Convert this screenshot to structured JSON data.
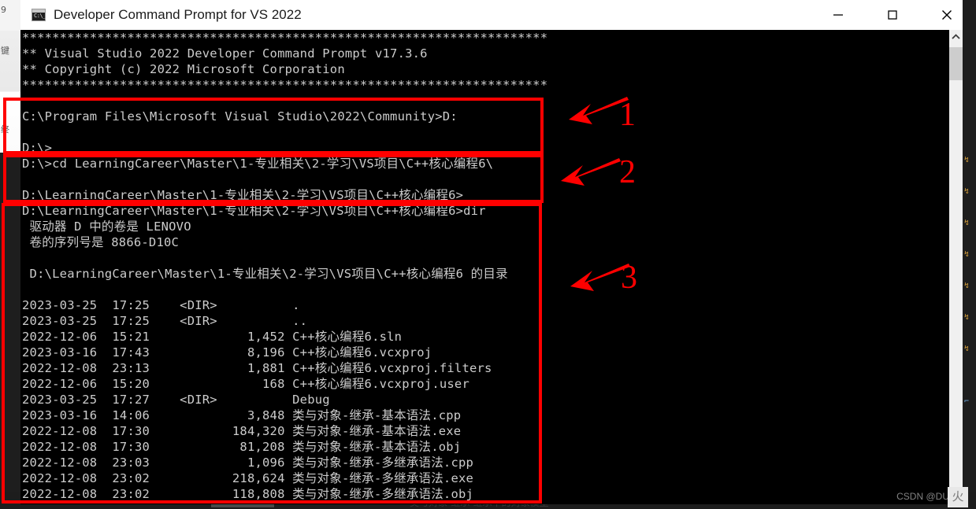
{
  "window": {
    "title": "Developer Command Prompt for VS 2022",
    "icon_name": "console-app-icon",
    "icon_text": "C:\\_",
    "controls": {
      "minimize": "Minimize",
      "maximize": "Maximize",
      "close": "Close"
    }
  },
  "scrollbar": {
    "up_arrow": "scroll-up",
    "thumb": "scroll-thumb"
  },
  "console": {
    "lines": [
      "**********************************************************************",
      "** Visual Studio 2022 Developer Command Prompt v17.3.6",
      "** Copyright (c) 2022 Microsoft Corporation",
      "**********************************************************************",
      "",
      "C:\\Program Files\\Microsoft Visual Studio\\2022\\Community>D:",
      "",
      "D:\\>",
      "D:\\>cd LearningCareer\\Master\\1-专业相关\\2-学习\\VS项目\\C++核心编程6\\",
      "",
      "D:\\LearningCareer\\Master\\1-专业相关\\2-学习\\VS项目\\C++核心编程6>",
      "D:\\LearningCareer\\Master\\1-专业相关\\2-学习\\VS项目\\C++核心编程6>dir",
      " 驱动器 D 中的卷是 LENOVO",
      " 卷的序列号是 8866-D10C",
      "",
      " D:\\LearningCareer\\Master\\1-专业相关\\2-学习\\VS项目\\C++核心编程6 的目录",
      "",
      "2023-03-25  17:25    <DIR>          .",
      "2023-03-25  17:25    <DIR>          ..",
      "2022-12-06  15:21             1,452 C++核心编程6.sln",
      "2023-03-16  17:43             8,196 C++核心编程6.vcxproj",
      "2022-12-08  23:13             1,881 C++核心编程6.vcxproj.filters",
      "2022-12-06  15:20               168 C++核心编程6.vcxproj.user",
      "2023-03-25  17:27    <DIR>          Debug",
      "2023-03-16  14:06             3,848 类与对象-继承-基本语法.cpp",
      "2022-12-08  17:30           184,320 类与对象-继承-基本语法.exe",
      "2022-12-08  17:30            81,208 类与对象-继承-基本语法.obj",
      "2022-12-08  23:03             1,096 类与对象-继承-多继承语法.cpp",
      "2022-12-08  23:02           218,624 类与对象-继承-多继承语法.exe",
      "2022-12-08  23:02           118,808 类与对象-继承-多继承语法.obj"
    ]
  },
  "annotations": {
    "color": "#ff0000",
    "items": [
      {
        "number": "1",
        "arrow": "arrow-left-1"
      },
      {
        "number": "2",
        "arrow": "arrow-left-2"
      },
      {
        "number": "3",
        "arrow": "arrow-left-3"
      }
    ]
  },
  "background": {
    "bottom_text": "类与对象-继承-继承中的对象模型",
    "left_glyphs": [
      "9",
      "键",
      "终"
    ],
    "right_marks": [
      "↯",
      "↯",
      "↯",
      "↯",
      "↯",
      "↯",
      "↯",
      "⌐"
    ]
  },
  "watermark": {
    "text": "CSDN @DU-咔",
    "logo": "火"
  }
}
